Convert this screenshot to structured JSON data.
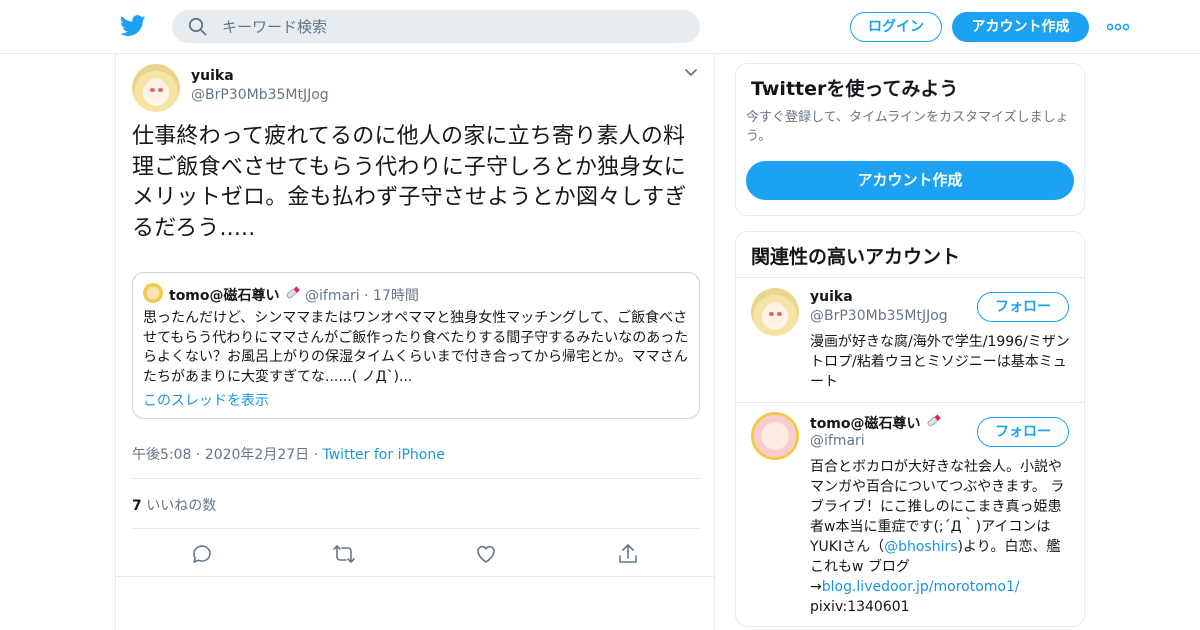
{
  "header": {
    "search_placeholder": "キーワード検索",
    "login_label": "ログイン",
    "signup_label": "アカウント作成",
    "brand_color": "#1da1f2",
    "icons": [
      "twitter-logo",
      "search-icon",
      "more-icon"
    ]
  },
  "tweet": {
    "author_name": "yuika",
    "author_handle": "@BrP30Mb35MtJJog",
    "text": "仕事終わって疲れてるのに他人の家に立ち寄り素人の料理ご飯食べさせてもらう代わりに子守しろとか独身女にメリットゼロ。金も払わず子守させようとか図々しすぎるだろう.....",
    "quote": {
      "author_name": "tomo@磁石尊い",
      "author_handle": "@ifmari",
      "time_sep": "·",
      "time": "17時間",
      "text": "思ったんだけど、シンママまたはワンオペママと独身女性マッチングして、ご飯食べさせてもらう代わりにママさんがご飯作ったり食べたりする間子守するみたいなのあったらよくない？お風呂上がりの保湿タイムくらいまで付き合ってから帰宅とか。ママさんたちがあまりに大変すぎてな......( ノД`)...",
      "thread_link": "このスレッドを表示"
    },
    "timestamp": "午後5:08 · 2020年2月27日",
    "meta_sep": " · ",
    "source": "Twitter for iPhone",
    "likes_count": "7",
    "likes_label": "いいねの数",
    "actions": [
      "reply-icon",
      "retweet-icon",
      "like-icon",
      "share-icon"
    ]
  },
  "sidebar": {
    "signup_card": {
      "title": "Twitterを使ってみよう",
      "subtitle": "今すぐ登録して、タイムラインをカスタマイズしましょう。",
      "button": "アカウント作成"
    },
    "related": {
      "title": "関連性の高いアカウント",
      "follow_label": "フォロー",
      "accounts": [
        {
          "name": "yuika",
          "handle": "@BrP30Mb35MtJJog",
          "bio": "漫画が好きな腐/海外で学生/1996/ミザントロプ/粘着ウヨとミソジニーは基本ミュート"
        },
        {
          "name": "tomo@磁石尊い",
          "handle": "@ifmari",
          "bio_before": "百合とボカロが大好きな社会人。小説やマンガや百合についてつぶやきます。 ラブライブ！にこ推しのにこまき真っ姫患者w本当に重症です(;´Д｀)アイコンはYUKIさん（",
          "bio_mention": "@bhoshirs",
          "bio_middle": ")より。白恋、艦これもw ブログ→",
          "bio_link": "blog.livedoor.jp/morotomo1/",
          "bio_after": " pixiv:1340601"
        }
      ]
    }
  }
}
